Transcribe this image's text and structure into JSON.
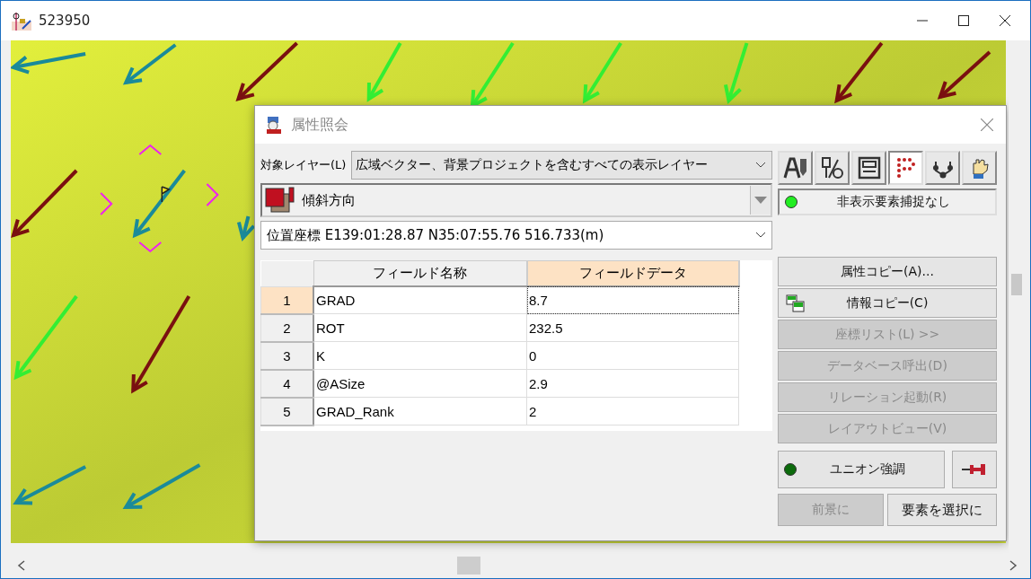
{
  "window": {
    "title": "523950"
  },
  "dialog": {
    "title": "属性照会",
    "layer_label": "対象レイヤー(L)",
    "layer_select": "広域ベクター、背景プロジェクトを含むすべての表示レイヤー",
    "feature_select": "傾斜方向",
    "coordinate_select": "位置座標 E139:01:28.87 N35:07:55.76 516.733(m)",
    "tools": [
      {
        "kind": "label",
        "selected": false
      },
      {
        "kind": "split",
        "selected": false
      },
      {
        "kind": "frame",
        "selected": false
      },
      {
        "kind": "points",
        "selected": true
      },
      {
        "kind": "nodes",
        "selected": false
      },
      {
        "kind": "hand",
        "selected": false
      }
    ],
    "hidden_capture": {
      "label": "非表示要素捕捉なし",
      "on": true
    },
    "table": {
      "columns": [
        {
          "label": "フィールド名称",
          "selected": false
        },
        {
          "label": "フィールドデータ",
          "selected": true
        }
      ],
      "rows": [
        {
          "number": "1",
          "name": "GRAD",
          "value": "8.7",
          "selected": true
        },
        {
          "number": "2",
          "name": "ROT",
          "value": "232.5",
          "selected": false
        },
        {
          "number": "3",
          "name": "K",
          "value": "0",
          "selected": false
        },
        {
          "number": "4",
          "name": "@ASize",
          "value": "2.9",
          "selected": false
        },
        {
          "number": "5",
          "name": "GRAD_Rank",
          "value": "2",
          "selected": false
        }
      ]
    },
    "actions": [
      {
        "label": "属性コピー(A)...",
        "kind": "plain",
        "disabled": false
      },
      {
        "label": "情報コピー(C)",
        "kind": "copy",
        "disabled": false
      },
      {
        "label": "座標リスト(L) >>",
        "kind": "plain",
        "disabled": true
      },
      {
        "label": "データベース呼出(D)",
        "kind": "plain",
        "disabled": true
      },
      {
        "label": "リレーション起動(R)",
        "kind": "plain",
        "disabled": true
      },
      {
        "label": "レイアウトビュー(V)",
        "kind": "plain",
        "disabled": true
      }
    ],
    "union": {
      "label": "ユニオン強調",
      "on": false
    },
    "bottom_buttons": [
      {
        "label": "前景に",
        "disabled": true
      },
      {
        "label": "要素を選択に",
        "disabled": false
      }
    ]
  }
}
